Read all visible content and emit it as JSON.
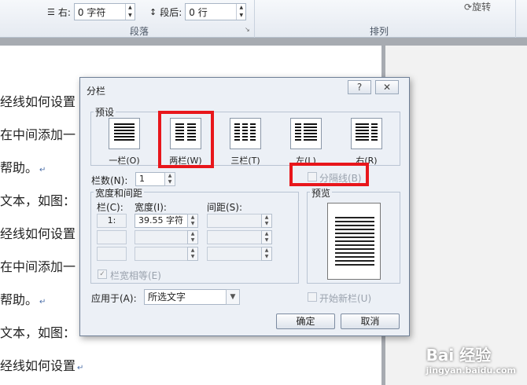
{
  "ribbon": {
    "indent_right_label": "右:",
    "indent_right_value": "0 字符",
    "space_after_label": "段后:",
    "space_after_value": "0 行",
    "group_paragraph": "段落",
    "group_arrange": "排列",
    "rotate_label": "旋转"
  },
  "document": {
    "lines": [
      "经线如何设置",
      "在中间添加一",
      "帮助。",
      "文本，如图：",
      "经线如何设置",
      "在中间添加一",
      "帮助。",
      "文本，如图：",
      "经线如何设置"
    ]
  },
  "dialog": {
    "title": "分栏",
    "help_btn": "?",
    "close_btn": "✕",
    "presets_label": "预设",
    "presets": [
      {
        "label": "一栏(O)"
      },
      {
        "label": "两栏(W)"
      },
      {
        "label": "三栏(T)"
      },
      {
        "label": "左(L)"
      },
      {
        "label": "右(R)"
      }
    ],
    "num_cols_label": "栏数(N):",
    "num_cols_value": "1",
    "separator_label": "分隔线(B)",
    "width_spacing_label": "宽度和间距",
    "col_header": "栏(C):",
    "width_header": "宽度(I):",
    "spacing_header": "间距(S):",
    "row1_col": "1:",
    "row1_width": "39.55 字符",
    "equal_width_label": "栏宽相等(E)",
    "apply_label": "应用于(A):",
    "apply_value": "所选文字",
    "preview_label": "预览",
    "new_column_label": "开始新栏(U)",
    "ok": "确定",
    "cancel": "取消"
  },
  "watermark": {
    "brand": "Bai 经验",
    "url": "jingyan.baidu.com"
  }
}
